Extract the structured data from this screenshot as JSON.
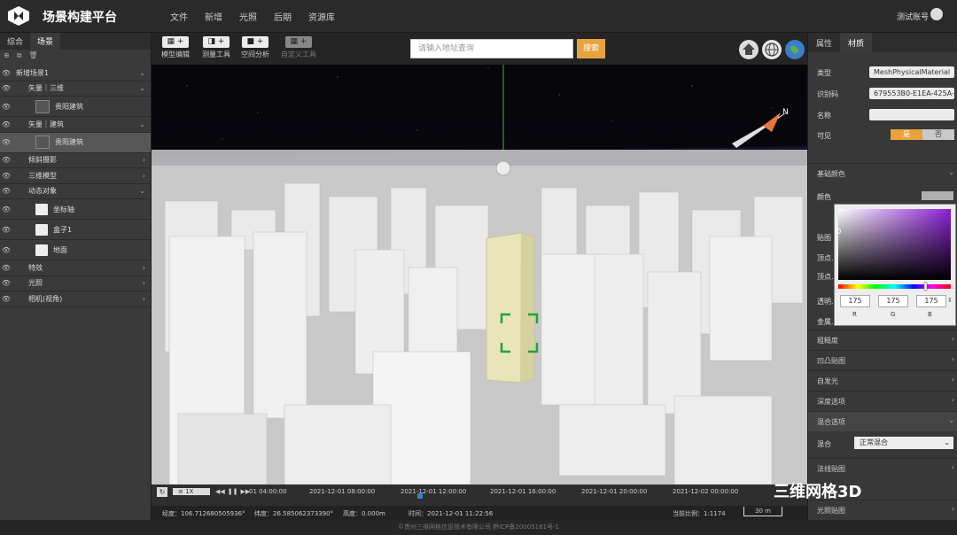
{
  "header": {
    "title": "场景构建平台",
    "menu": [
      "文件",
      "新增",
      "光照",
      "后期",
      "资源库"
    ],
    "account": "测试账号"
  },
  "left_panel": {
    "tabs": [
      "综合",
      "场景"
    ],
    "tree": [
      {
        "label": "新增场景1",
        "type": "root"
      },
      {
        "label": "矢量｜三维",
        "type": "group"
      },
      {
        "label": "贵阳建筑",
        "type": "leaf-dark"
      },
      {
        "label": "矢量｜建筑",
        "type": "group"
      },
      {
        "label": "贵阳建筑",
        "type": "leaf-dark-sel"
      },
      {
        "label": "倾斜摄影",
        "type": "group-collapsed"
      },
      {
        "label": "三维模型",
        "type": "group-collapsed"
      },
      {
        "label": "动态对象",
        "type": "group"
      },
      {
        "label": "坐标轴",
        "type": "leaf"
      },
      {
        "label": "盒子1",
        "type": "leaf"
      },
      {
        "label": "地面",
        "type": "leaf"
      },
      {
        "label": "特效",
        "type": "group-collapsed"
      },
      {
        "label": "光照",
        "type": "group-collapsed"
      },
      {
        "label": "相机(视角)",
        "type": "group-collapsed"
      }
    ]
  },
  "toolbar": {
    "tools": [
      "模型编辑",
      "测量工具",
      "空间分析",
      "自定义工具"
    ],
    "search_placeholder": "请输入地址查询",
    "search_button": "搜索"
  },
  "timeline": {
    "speed": "1X",
    "ticks": [
      "01 04:00:00",
      "2021-12-01 08:00:00",
      "2021-12-01 12:00:00",
      "2021-12-01 16:00:00",
      "2021-12-01 20:00:00",
      "2021-12-02 00:00:00"
    ],
    "lon": "经度：106.712680505936°",
    "lat": "纬度：26.5850623733​90°",
    "height": "高度：0.000m",
    "time": "时间：2021-12-01 11:22:56",
    "scale": "当前比例：1:1174",
    "scale_bar": "30 m"
  },
  "right_panel": {
    "tabs": [
      "属性",
      "材质"
    ],
    "type_label": "类型",
    "type_value": "MeshPhysicalMaterial",
    "id_label": "识别码",
    "id_value": "679553B0-E1EA-425A-A",
    "name_label": "名称",
    "visible_label": "可见",
    "visible_yes": "是",
    "visible_no": "否",
    "base_color": "基础颜色",
    "color_label": "颜色",
    "rgb": {
      "r": "175",
      "g": "175",
      "b": "175",
      "r_label": "R",
      "g_label": "G",
      "b_label": "B"
    },
    "partial_labels": [
      "贴图",
      "顶点...",
      "顶点...",
      "透明...",
      "金属..."
    ],
    "sections": [
      "粗糙度",
      "凹凸贴图",
      "自发光",
      "深度选项",
      "混合选项"
    ],
    "blend_label": "混合",
    "blend_value": "正常混合",
    "sections2": [
      "法线贴图",
      "光照贴图"
    ]
  },
  "footer": "©贵州三维网格信息技术有限公司  黔ICP备20005161号-1",
  "watermark": "三维网格3D",
  "colors": {
    "accent": "#e8a33c",
    "panel": "#3a3a3a",
    "highlight": "#e8e5b8"
  }
}
